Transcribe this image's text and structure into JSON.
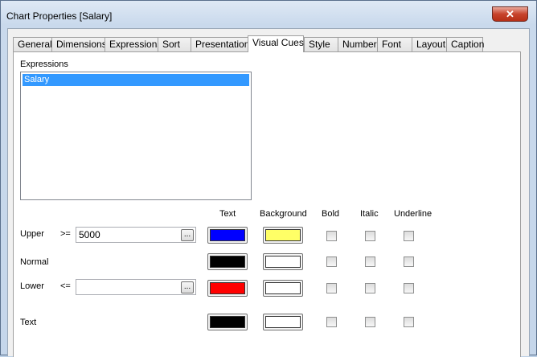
{
  "window": {
    "title": "Chart Properties [Salary]",
    "close_glyph": "✕"
  },
  "tabs": [
    {
      "label": "General"
    },
    {
      "label": "Dimensions"
    },
    {
      "label": "Expressions"
    },
    {
      "label": "Sort"
    },
    {
      "label": "Presentation"
    },
    {
      "label": "Visual Cues",
      "active": true
    },
    {
      "label": "Style"
    },
    {
      "label": "Number"
    },
    {
      "label": "Font"
    },
    {
      "label": "Layout"
    },
    {
      "label": "Caption"
    }
  ],
  "expressions": {
    "label": "Expressions",
    "items": [
      "Salary"
    ],
    "selected": "Salary"
  },
  "columns": {
    "text": "Text",
    "background": "Background",
    "bold": "Bold",
    "italic": "Italic",
    "underline": "Underline"
  },
  "rows": {
    "upper": {
      "label": "Upper",
      "operator": ">=",
      "value": "5000",
      "browse": "...",
      "text_color": "#0000ff",
      "background_color": "#ffff66",
      "bold": false,
      "italic": false,
      "underline": false
    },
    "normal": {
      "label": "Normal",
      "text_color": "#000000",
      "background_color": "#ffffff",
      "bold": false,
      "italic": false,
      "underline": false
    },
    "lower": {
      "label": "Lower",
      "operator": "<=",
      "value": "",
      "browse": "...",
      "text_color": "#ff0000",
      "background_color": "#ffffff",
      "bold": false,
      "italic": false,
      "underline": false
    },
    "text": {
      "label": "Text",
      "text_color": "#000000",
      "background_color": "#ffffff",
      "bold": false,
      "italic": false,
      "underline": false
    }
  }
}
